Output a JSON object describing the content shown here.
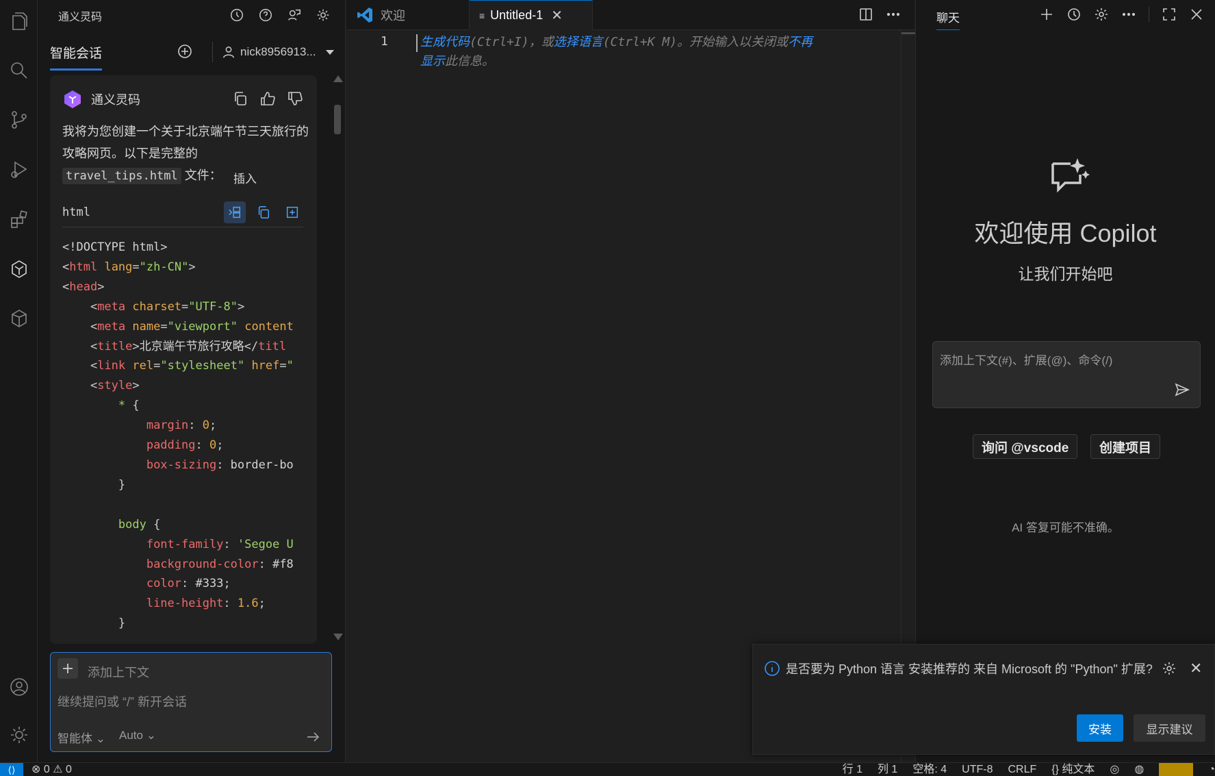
{
  "sidebar": {
    "title": "通义灵码",
    "tab_label": "智能会话",
    "username": "nick8956913...",
    "bot_name": "通义灵码",
    "answer_line1": "我将为您创建一个关于北京端午节三天旅行的攻略网页。以下是完整的",
    "answer_filename": "travel_tips.html",
    "answer_suffix": " 文件：",
    "tooltip_insert": "插入",
    "code_lang": "html",
    "input_add_context": "添加上下文",
    "input_placeholder": "继续提问或 “/” 新开会话",
    "mode_label": "智能体 ⌄",
    "model_label": "Auto ⌄"
  },
  "code": {
    "doctype": "<!DOCTYPE html>",
    "html_lang_attr": "lang",
    "html_lang_val": "\"zh-CN\"",
    "charset_attr": "charset",
    "charset_val": "\"UTF-8\"",
    "viewport_name_attr": "name",
    "viewport_name_val": "\"viewport\"",
    "viewport_content_attr": "content",
    "title_text": "北京端午节旅行攻略",
    "link_rel_attr": "rel",
    "link_rel_val": "\"stylesheet\"",
    "link_href_attr": "href",
    "link_href_val": "\"",
    "selector_all": "*",
    "margin_prop": "margin",
    "margin_val": "0",
    "padding_prop": "padding",
    "padding_val": "0",
    "boxsizing_prop": "box-sizing",
    "boxsizing_val": "border-bo",
    "selector_body": "body",
    "fontfamily_prop": "font-family",
    "fontfamily_val": "'Segoe U",
    "bgcolor_prop": "background-color",
    "bgcolor_val": "#f8",
    "color_prop": "color",
    "color_val": "#333",
    "lineheight_prop": "line-height",
    "lineheight_val": "1.6"
  },
  "editor": {
    "tab_welcome": "欢迎",
    "tab_untitled": "Untitled-1",
    "line_number": "1",
    "hint_link1": "生成代码",
    "hint_part1": "(Ctrl+I)，或",
    "hint_link2": "选择语言",
    "hint_part2": "(Ctrl+K M)。开始输入以关闭或",
    "hint_link3": "不再",
    "hint_link4": "显示",
    "hint_part3": "此信息。"
  },
  "chat": {
    "tab_label": "聊天",
    "welcome_title": "欢迎使用 Copilot",
    "welcome_subtitle": "让我们开始吧",
    "input_placeholder": "添加上下文(#)、扩展(@)、命令(/)",
    "chip_ask": "询问 @vscode",
    "chip_create": "创建项目",
    "disclaimer": "AI 答复可能不准确。"
  },
  "toast": {
    "message": "是否要为 Python 语言 安装推荐的 来自 Microsoft 的 \"Python\" 扩展?",
    "install_label": "安装",
    "show_suggestions_label": "显示建议"
  },
  "status": {
    "problems": "⊗ 0 ⚠ 0",
    "line": "行 1",
    "col": "列 1",
    "spaces": "空格: 4",
    "encoding": "UTF-8",
    "eol": "CRLF",
    "language": "{} 纯文本"
  },
  "colors": {
    "accent": "#0078d4",
    "link": "#3794ff",
    "tag": "#ef6a6a",
    "attr": "#e5a84b",
    "string": "#9ed36a"
  }
}
